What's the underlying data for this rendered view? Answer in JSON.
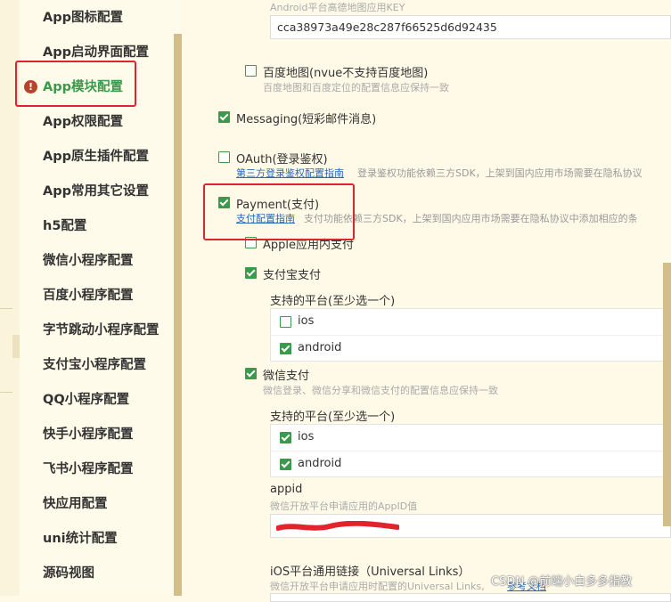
{
  "sidebar": {
    "items": [
      {
        "label": "App图标配置"
      },
      {
        "label": "App启动界面配置"
      },
      {
        "label": "App模块配置",
        "active": true
      },
      {
        "label": "App权限配置"
      },
      {
        "label": "App原生插件配置"
      },
      {
        "label": "App常用其它设置"
      },
      {
        "label": "h5配置"
      },
      {
        "label": "微信小程序配置"
      },
      {
        "label": "百度小程序配置"
      },
      {
        "label": "字节跳动小程序配置"
      },
      {
        "label": "支付宝小程序配置"
      },
      {
        "label": "QQ小程序配置"
      },
      {
        "label": "快手小程序配置"
      },
      {
        "label": "飞书小程序配置"
      },
      {
        "label": "快应用配置"
      },
      {
        "label": "uni统计配置"
      },
      {
        "label": "源码视图"
      }
    ],
    "warning_icon": "!"
  },
  "main": {
    "android_key_hint": "Android平台高德地图应用KEY",
    "android_key_value": "cca38973a49e28c287f66525d6d92435",
    "baidu_map": {
      "label": "百度地图(nvue不支持百度地图)",
      "hint": "百度地图和百度定位的配置信息应保持一致",
      "checked": false
    },
    "messaging": {
      "label": "Messaging(短彩邮件消息)",
      "checked": true
    },
    "oauth": {
      "label": "OAuth(登录鉴权)",
      "link": "第三方登录鉴权配置指南",
      "hint": "登录鉴权功能依赖三方SDK，上架到国内应用市场需要在隐私协议",
      "checked": false
    },
    "payment": {
      "label": "Payment(支付)",
      "link": "支付配置指南",
      "hint": "支付功能依赖三方SDK，上架到国内应用市场需要在隐私协议中添加相应的条",
      "checked": true
    },
    "apple_pay": {
      "label": "Apple应用内支付",
      "checked": false
    },
    "alipay": {
      "label": "支付宝支付",
      "checked": true,
      "platforms_label": "支持的平台(至少选一个)",
      "platforms": [
        {
          "label": "ios",
          "checked": false
        },
        {
          "label": "android",
          "checked": true
        }
      ]
    },
    "wxpay": {
      "label": "微信支付",
      "hint": "微信登录、微信分享和微信支付的配置信息应保持一致",
      "checked": true,
      "platforms_label": "支持的平台(至少选一个)",
      "platforms": [
        {
          "label": "ios",
          "checked": true
        },
        {
          "label": "android",
          "checked": true
        }
      ]
    },
    "appid": {
      "label": "appid",
      "hint": "微信开放平台申请应用的AppID值"
    },
    "universal_links": {
      "label": "iOS平台通用链接（Universal Links）",
      "hint": "微信开放平台申请应用时配置的Universal Links,",
      "link": "参考文档"
    }
  },
  "watermark": "CSDN @前端小白多多指教",
  "colors": {
    "accent": "#3a9a4b",
    "highlight": "#e3232c",
    "link": "#2b68b7",
    "scrollbar": "#d3be8b"
  }
}
